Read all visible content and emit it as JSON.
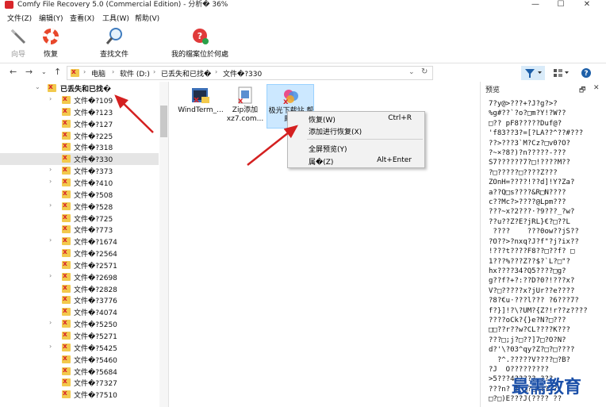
{
  "window": {
    "title": "Comfy File Recovery 5.0 (Commercial Edition) - 分析� 36%",
    "controls": [
      "—",
      "☐",
      "✕"
    ]
  },
  "menu": [
    "文件(Z)",
    "编辑(Y)",
    "查看(X)",
    "工具(W)",
    "帮助(V)"
  ],
  "toolbar": {
    "buttons": [
      {
        "label": "向导",
        "icon": "wand-icon",
        "enabled": false
      },
      {
        "label": "恢复",
        "icon": "lifebuoy-icon",
        "enabled": true
      },
      {
        "label": "查找文件",
        "icon": "magnifier-icon",
        "enabled": true
      },
      {
        "label": "我的檔案位於何處",
        "icon": "help-globe-icon",
        "enabled": true
      }
    ]
  },
  "nav": {
    "breadcrumb": [
      "电脑",
      "软件 (D:)",
      "已丢失和已找�",
      "文件�?330"
    ],
    "refresh_icon": "refresh-icon"
  },
  "tree": {
    "root_label": "已丢失和已找�",
    "items": [
      {
        "label": "文件�?109",
        "expandable": true
      },
      {
        "label": "文件�?123",
        "expandable": false
      },
      {
        "label": "文件�?127",
        "expandable": false
      },
      {
        "label": "文件�?225",
        "expandable": false
      },
      {
        "label": "文件�?318",
        "expandable": false
      },
      {
        "label": "文件�?330",
        "expandable": false,
        "selected": true
      },
      {
        "label": "文件�?373",
        "expandable": true
      },
      {
        "label": "文件�?410",
        "expandable": true
      },
      {
        "label": "文件�?508",
        "expandable": false
      },
      {
        "label": "文件�?528",
        "expandable": true
      },
      {
        "label": "文件�?725",
        "expandable": false
      },
      {
        "label": "文件�?773",
        "expandable": false
      },
      {
        "label": "文件�?1674",
        "expandable": true
      },
      {
        "label": "文件�?2564",
        "expandable": false
      },
      {
        "label": "文件�?2571",
        "expandable": false
      },
      {
        "label": "文件�?2698",
        "expandable": true
      },
      {
        "label": "文件�?2828",
        "expandable": false
      },
      {
        "label": "文件�?3776",
        "expandable": false
      },
      {
        "label": "文件�?4074",
        "expandable": false
      },
      {
        "label": "文件�?5250",
        "expandable": true
      },
      {
        "label": "文件�?5271",
        "expandable": false
      },
      {
        "label": "文件�?5425",
        "expandable": true
      },
      {
        "label": "文件�?5460",
        "expandable": false
      },
      {
        "label": "文件�?5684",
        "expandable": false
      },
      {
        "label": "文件�?7327",
        "expandable": false
      },
      {
        "label": "文件�?7510",
        "expandable": false
      }
    ]
  },
  "files": [
    {
      "name": "WindTerm_...",
      "icon": "deleted-file-icon",
      "selected": false
    },
    {
      "name": "Zip添加 xz7.com...",
      "icon": "zip-file-icon",
      "selected": false
    },
    {
      "name": "极光下载站 帮助...",
      "icon": "app-file-icon",
      "selected": true
    }
  ],
  "context_menu": {
    "items": [
      {
        "label": "恢复(W)",
        "shortcut": "Ctrl+R"
      },
      {
        "label": "添加进行恢复(X)",
        "shortcut": ""
      },
      {
        "label": "全屏预览(Y)",
        "shortcut": ""
      },
      {
        "label": "属�(Z)",
        "shortcut": "Alt+Enter"
      }
    ]
  },
  "preview": {
    "title": "预览",
    "pin": "🗗",
    "close": "✕",
    "lines": [
      "7?y@>???+?J?g?>?",
      "%g#??`?o?□m?Y!?W??",
      "□?? pF8?????Duf@?",
      "'f83??3?=[?LA??^??#???",
      "??>???3`M?Cz?□v0?O?",
      "?~×?8?)?n?????-???",
      "S7??????7?□!????M??",
      "?□?????□????Z???",
      "ZOnH=????!??d]!Y?Za?",
      "a??Q□s????&R□N????",
      "c??Mc?>????@Lpm???",
      "???~x?2???·?9???_?w?",
      "??u??Z?E?jRL}€?□??L",
      " ????    ???0ow??jS??",
      "?O??>?nxq?J?f\"?j?ix??",
      "!???t????F8??□??f? □",
      "1???%???Z??$?`L?□\"?",
      "hx????34?Q5????□g?",
      "g??f?+?:??D?0?!???x?",
      "V?□?????x?jUr??e????",
      "?8?€u·???l??? ?6???7?",
      "f?}]!?\\?UM?{Z?!r??z????",
      "????oCk?{}e?N?□???",
      "□□??r??w?CL????K???",
      "???□;j?□??]7□?O?N?",
      "d?'\\?03^qy?Z?□?□????",
      "  ?^.?????V????□?B?",
      "?J  O?????????",
      ">5???4????? ???",
      "???n? ? □?□??? ?",
      "□?□)E???J(???? ??"
    ]
  },
  "watermark": "最需教育"
}
